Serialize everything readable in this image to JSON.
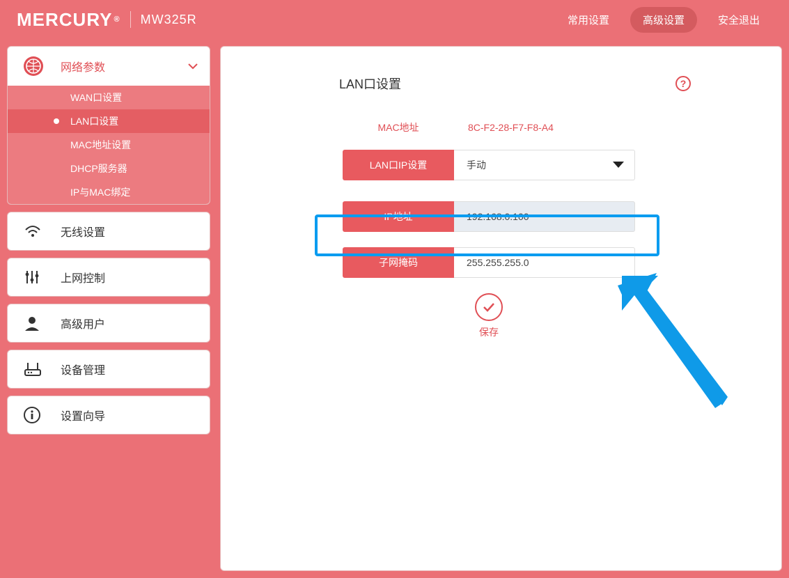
{
  "header": {
    "brand": "MERCURY",
    "model": "MW325R",
    "nav": {
      "common": "常用设置",
      "advanced": "高级设置",
      "logout": "安全退出"
    }
  },
  "sidebar": {
    "network": {
      "label": "网络参数",
      "items": {
        "wan": "WAN口设置",
        "lan": "LAN口设置",
        "mac": "MAC地址设置",
        "dhcp": "DHCP服务器",
        "ipmac": "IP与MAC绑定"
      }
    },
    "wireless": "无线设置",
    "access": "上网控制",
    "advanced_user": "高级用户",
    "device_mgmt": "设备管理",
    "wizard": "设置向导"
  },
  "main": {
    "title": "LAN口设置",
    "help_tooltip": "?",
    "mac_label": "MAC地址",
    "mac_value": "8C-F2-28-F7-F8-A4",
    "lan_ip_setting_label": "LAN口IP设置",
    "lan_ip_setting_value": "手动",
    "ip_label": "IP地址",
    "ip_value": "192.168.0.100",
    "subnet_label": "子网掩码",
    "subnet_value": "255.255.255.0",
    "save_label": "保存"
  }
}
